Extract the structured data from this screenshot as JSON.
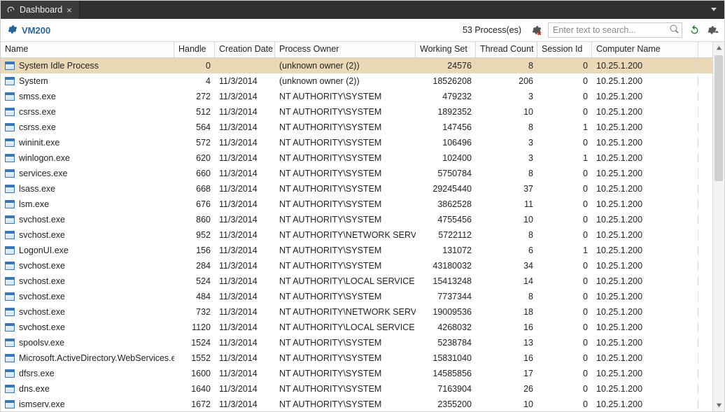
{
  "tab": {
    "title": "Dashboard"
  },
  "toolbar": {
    "vm_label": "VM200",
    "process_count_label": "53 Process(es)",
    "search_placeholder": "Enter text to search..."
  },
  "columns": {
    "name": "Name",
    "handle": "Handle",
    "creation_date": "Creation Date",
    "process_owner": "Process Owner",
    "working_set": "Working Set",
    "thread_count": "Thread Count",
    "session_id": "Session Id",
    "computer_name": "Computer Name"
  },
  "rows": [
    {
      "name": "System Idle Process",
      "handle": "0",
      "date": "",
      "owner": "(unknown owner (2))",
      "ws": "24576",
      "tc": "8",
      "sid": "0",
      "comp": "10.25.1.200",
      "selected": true
    },
    {
      "name": "System",
      "handle": "4",
      "date": "11/3/2014",
      "owner": "(unknown owner (2))",
      "ws": "18526208",
      "tc": "206",
      "sid": "0",
      "comp": "10.25.1.200"
    },
    {
      "name": "smss.exe",
      "handle": "272",
      "date": "11/3/2014",
      "owner": "NT AUTHORITY\\SYSTEM",
      "ws": "479232",
      "tc": "3",
      "sid": "0",
      "comp": "10.25.1.200"
    },
    {
      "name": "csrss.exe",
      "handle": "512",
      "date": "11/3/2014",
      "owner": "NT AUTHORITY\\SYSTEM",
      "ws": "1892352",
      "tc": "10",
      "sid": "0",
      "comp": "10.25.1.200"
    },
    {
      "name": "csrss.exe",
      "handle": "564",
      "date": "11/3/2014",
      "owner": "NT AUTHORITY\\SYSTEM",
      "ws": "147456",
      "tc": "8",
      "sid": "1",
      "comp": "10.25.1.200"
    },
    {
      "name": "wininit.exe",
      "handle": "572",
      "date": "11/3/2014",
      "owner": "NT AUTHORITY\\SYSTEM",
      "ws": "106496",
      "tc": "3",
      "sid": "0",
      "comp": "10.25.1.200"
    },
    {
      "name": "winlogon.exe",
      "handle": "620",
      "date": "11/3/2014",
      "owner": "NT AUTHORITY\\SYSTEM",
      "ws": "102400",
      "tc": "3",
      "sid": "1",
      "comp": "10.25.1.200"
    },
    {
      "name": "services.exe",
      "handle": "660",
      "date": "11/3/2014",
      "owner": "NT AUTHORITY\\SYSTEM",
      "ws": "5750784",
      "tc": "8",
      "sid": "0",
      "comp": "10.25.1.200"
    },
    {
      "name": "lsass.exe",
      "handle": "668",
      "date": "11/3/2014",
      "owner": "NT AUTHORITY\\SYSTEM",
      "ws": "29245440",
      "tc": "37",
      "sid": "0",
      "comp": "10.25.1.200"
    },
    {
      "name": "lsm.exe",
      "handle": "676",
      "date": "11/3/2014",
      "owner": "NT AUTHORITY\\SYSTEM",
      "ws": "3862528",
      "tc": "11",
      "sid": "0",
      "comp": "10.25.1.200"
    },
    {
      "name": "svchost.exe",
      "handle": "860",
      "date": "11/3/2014",
      "owner": "NT AUTHORITY\\SYSTEM",
      "ws": "4755456",
      "tc": "10",
      "sid": "0",
      "comp": "10.25.1.200"
    },
    {
      "name": "svchost.exe",
      "handle": "952",
      "date": "11/3/2014",
      "owner": "NT AUTHORITY\\NETWORK SERVICE",
      "ws": "5722112",
      "tc": "8",
      "sid": "0",
      "comp": "10.25.1.200"
    },
    {
      "name": "LogonUI.exe",
      "handle": "156",
      "date": "11/3/2014",
      "owner": "NT AUTHORITY\\SYSTEM",
      "ws": "131072",
      "tc": "6",
      "sid": "1",
      "comp": "10.25.1.200"
    },
    {
      "name": "svchost.exe",
      "handle": "284",
      "date": "11/3/2014",
      "owner": "NT AUTHORITY\\SYSTEM",
      "ws": "43180032",
      "tc": "34",
      "sid": "0",
      "comp": "10.25.1.200"
    },
    {
      "name": "svchost.exe",
      "handle": "524",
      "date": "11/3/2014",
      "owner": "NT AUTHORITY\\LOCAL SERVICE",
      "ws": "15413248",
      "tc": "14",
      "sid": "0",
      "comp": "10.25.1.200"
    },
    {
      "name": "svchost.exe",
      "handle": "484",
      "date": "11/3/2014",
      "owner": "NT AUTHORITY\\SYSTEM",
      "ws": "7737344",
      "tc": "8",
      "sid": "0",
      "comp": "10.25.1.200"
    },
    {
      "name": "svchost.exe",
      "handle": "732",
      "date": "11/3/2014",
      "owner": "NT AUTHORITY\\NETWORK SERVICE",
      "ws": "19009536",
      "tc": "18",
      "sid": "0",
      "comp": "10.25.1.200"
    },
    {
      "name": "svchost.exe",
      "handle": "1120",
      "date": "11/3/2014",
      "owner": "NT AUTHORITY\\LOCAL SERVICE",
      "ws": "4268032",
      "tc": "16",
      "sid": "0",
      "comp": "10.25.1.200"
    },
    {
      "name": "spoolsv.exe",
      "handle": "1524",
      "date": "11/3/2014",
      "owner": "NT AUTHORITY\\SYSTEM",
      "ws": "5238784",
      "tc": "13",
      "sid": "0",
      "comp": "10.25.1.200"
    },
    {
      "name": "Microsoft.ActiveDirectory.WebServices.exe",
      "handle": "1552",
      "date": "11/3/2014",
      "owner": "NT AUTHORITY\\SYSTEM",
      "ws": "15831040",
      "tc": "16",
      "sid": "0",
      "comp": "10.25.1.200"
    },
    {
      "name": "dfsrs.exe",
      "handle": "1600",
      "date": "11/3/2014",
      "owner": "NT AUTHORITY\\SYSTEM",
      "ws": "14585856",
      "tc": "17",
      "sid": "0",
      "comp": "10.25.1.200"
    },
    {
      "name": "dns.exe",
      "handle": "1640",
      "date": "11/3/2014",
      "owner": "NT AUTHORITY\\SYSTEM",
      "ws": "7163904",
      "tc": "26",
      "sid": "0",
      "comp": "10.25.1.200"
    },
    {
      "name": "ismserv.exe",
      "handle": "1672",
      "date": "11/3/2014",
      "owner": "NT AUTHORITY\\SYSTEM",
      "ws": "2355200",
      "tc": "10",
      "sid": "0",
      "comp": "10.25.1.200"
    }
  ]
}
